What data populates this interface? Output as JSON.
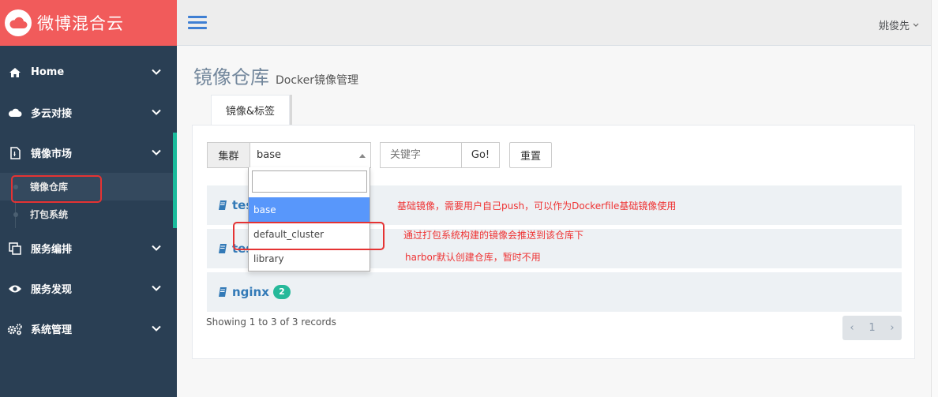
{
  "brand": {
    "title": "微博混合云",
    "logo_icon": "cloud-icon",
    "color": "#f15b5b"
  },
  "sidebar": {
    "items": [
      {
        "label": "Home",
        "icon": "home-icon"
      },
      {
        "label": "多云对接",
        "icon": "cloud-icon"
      },
      {
        "label": "镜像市场",
        "icon": "file-icon",
        "submenu": [
          {
            "label": "镜像仓库"
          },
          {
            "label": "打包系统"
          }
        ]
      },
      {
        "label": "服务编排",
        "icon": "clone-icon"
      },
      {
        "label": "服务发现",
        "icon": "eye-icon"
      },
      {
        "label": "系统管理",
        "icon": "cogs-icon"
      }
    ]
  },
  "topnav": {
    "user": "姚俊先"
  },
  "page": {
    "title": "镜像仓库",
    "subtitle": "Docker镜像管理",
    "tab": "镜像&标签"
  },
  "filter": {
    "cluster_label": "集群",
    "cluster_value": "base",
    "search_placeholder": "关键字",
    "go_label": "Go!",
    "reset_label": "重置"
  },
  "dropdown": {
    "options": [
      "base",
      "default_cluster",
      "library"
    ]
  },
  "repos": [
    {
      "name": "tes",
      "badge": ""
    },
    {
      "name": "tes",
      "badge": ""
    },
    {
      "name": "nginx",
      "badge": "2"
    }
  ],
  "records": {
    "summary": "Showing 1 to 3 of 3 records",
    "prev": "‹",
    "page": "1",
    "next": "›"
  },
  "annotations": [
    "基础镜像，需要用户自己push，可以作为Dockerfile基础镜像使用",
    "通过打包系统构建的镜像会推送到该仓库下",
    "harbor默认创建仓库，暂时不用"
  ],
  "colors": {
    "sidebar": "#2a3f54",
    "accent": "#1abb9c",
    "link": "#337ab7",
    "annotation": "#e53333",
    "highlight": "#5897fb"
  }
}
